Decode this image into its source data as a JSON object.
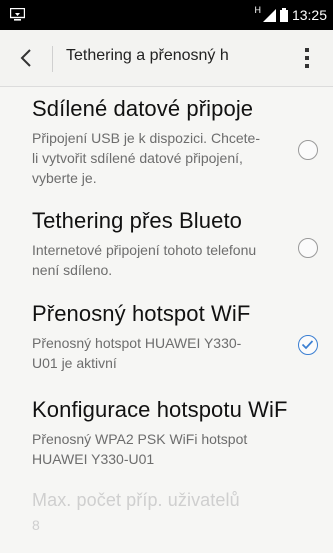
{
  "status": {
    "time": "13:25",
    "network": "H"
  },
  "appbar": {
    "title": "Tethering a přenosný h"
  },
  "items": [
    {
      "title": "Sdílené datové připoje",
      "subtitle": "Připojení USB je k dispozici. Chcete-li vytvořit sdílené datové připojení, vyberte je.",
      "checked": false
    },
    {
      "title": "Tethering přes Blueto",
      "subtitle": "Internetové připojení tohoto telefonu není sdíleno.",
      "checked": false
    },
    {
      "title": "Přenosný hotspot WiF",
      "subtitle": "Přenosný hotspot HUAWEI Y330-U01 je aktivní",
      "checked": true
    },
    {
      "title": "Konfigurace hotspotu WiF",
      "subtitle": "Přenosný WPA2 PSK WiFi hotspot HUAWEI Y330-U01"
    },
    {
      "title": "Max. počet příp. uživatelů",
      "subtitle": "8"
    }
  ]
}
